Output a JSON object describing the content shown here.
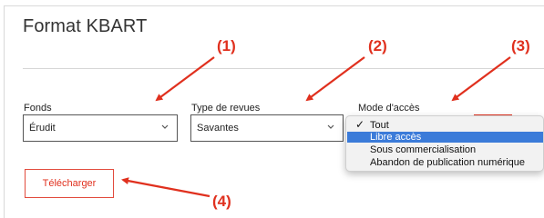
{
  "page": {
    "title": "Format KBART"
  },
  "annotations": {
    "a1": "(1)",
    "a2": "(2)",
    "a3": "(3)",
    "a4": "(4)"
  },
  "fields": {
    "fonds": {
      "label": "Fonds",
      "value": "Érudit"
    },
    "type_revues": {
      "label": "Type de revues",
      "value": "Savantes"
    },
    "mode_acces": {
      "label": "Mode d'accès",
      "options": [
        "Tout",
        "Libre accès",
        "Sous commercialisation",
        "Abandon de publication numérique"
      ],
      "checked_option": "Tout",
      "highlighted_option": "Libre accès"
    }
  },
  "actions": {
    "download_label": "Télécharger"
  },
  "icons": {
    "check": "checkmark-icon",
    "chevron": "chevron-down-icon"
  },
  "colors": {
    "accent": "#e0301e",
    "highlight": "#3b7bd9"
  }
}
